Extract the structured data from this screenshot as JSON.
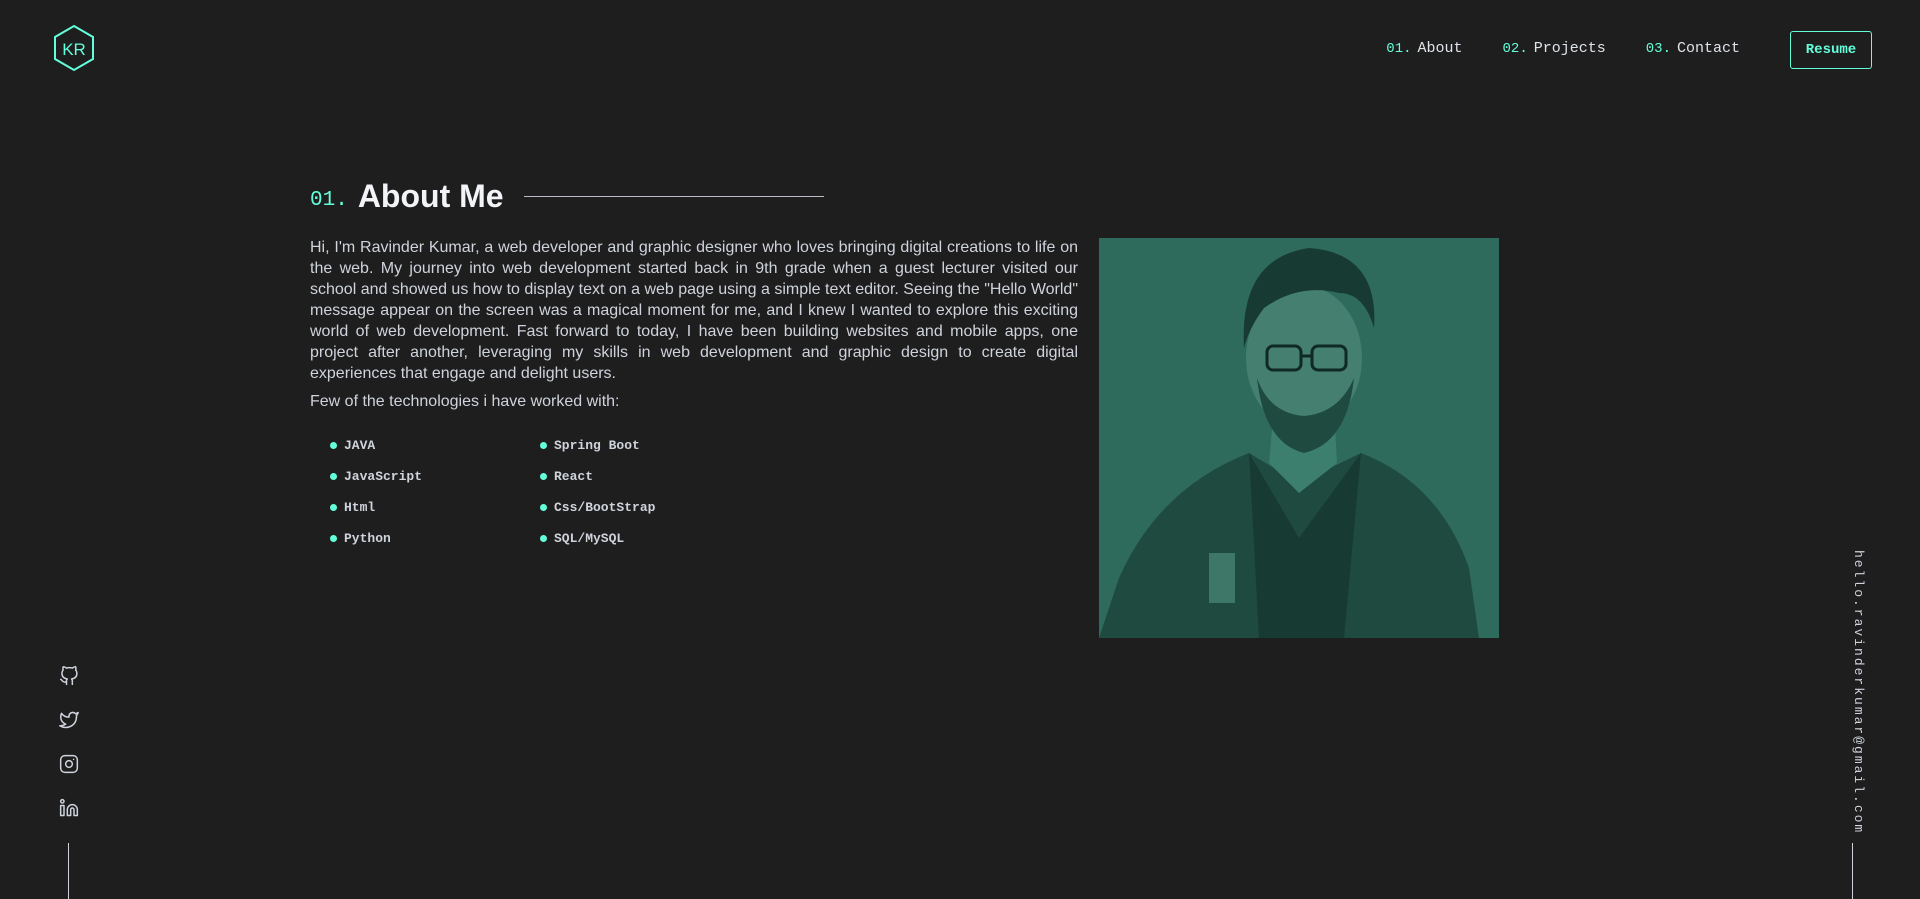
{
  "brand": {
    "logo_text": "KR",
    "accent_color": "#64ffda",
    "background_color": "#1e1e1e"
  },
  "nav": {
    "items": [
      {
        "number": "01.",
        "label": "About"
      },
      {
        "number": "02.",
        "label": "Projects"
      },
      {
        "number": "03.",
        "label": "Contact"
      }
    ],
    "resume_label": "Resume"
  },
  "about": {
    "section_number": "01.",
    "title": "About Me",
    "paragraph": "Hi, I'm Ravinder Kumar, a web developer and graphic designer who loves bringing digital creations to life on the web. My journey into web development started back in 9th grade when a guest lecturer visited our school and showed us how to display text on a web page using a simple text editor. Seeing the \"Hello World\" message appear on the screen was a magical moment for me, and I knew I wanted to explore this exciting world of web development. Fast forward to today, I have been building websites and mobile apps, one project after another, leveraging my skills in web development and graphic design to create digital experiences that engage and delight users.",
    "tech_intro": "Few of the technologies i have worked with:",
    "technologies": [
      "JAVA",
      "JavaScript",
      "Html",
      "Python",
      "Spring Boot",
      "React",
      "Css/BootStrap",
      "SQL/MySQL"
    ],
    "portrait_tint": "#2e6b5c"
  },
  "social": {
    "icons": [
      "github-icon",
      "twitter-icon",
      "instagram-icon",
      "linkedin-icon"
    ]
  },
  "email": "hello.ravinderkumar@gmail.com"
}
